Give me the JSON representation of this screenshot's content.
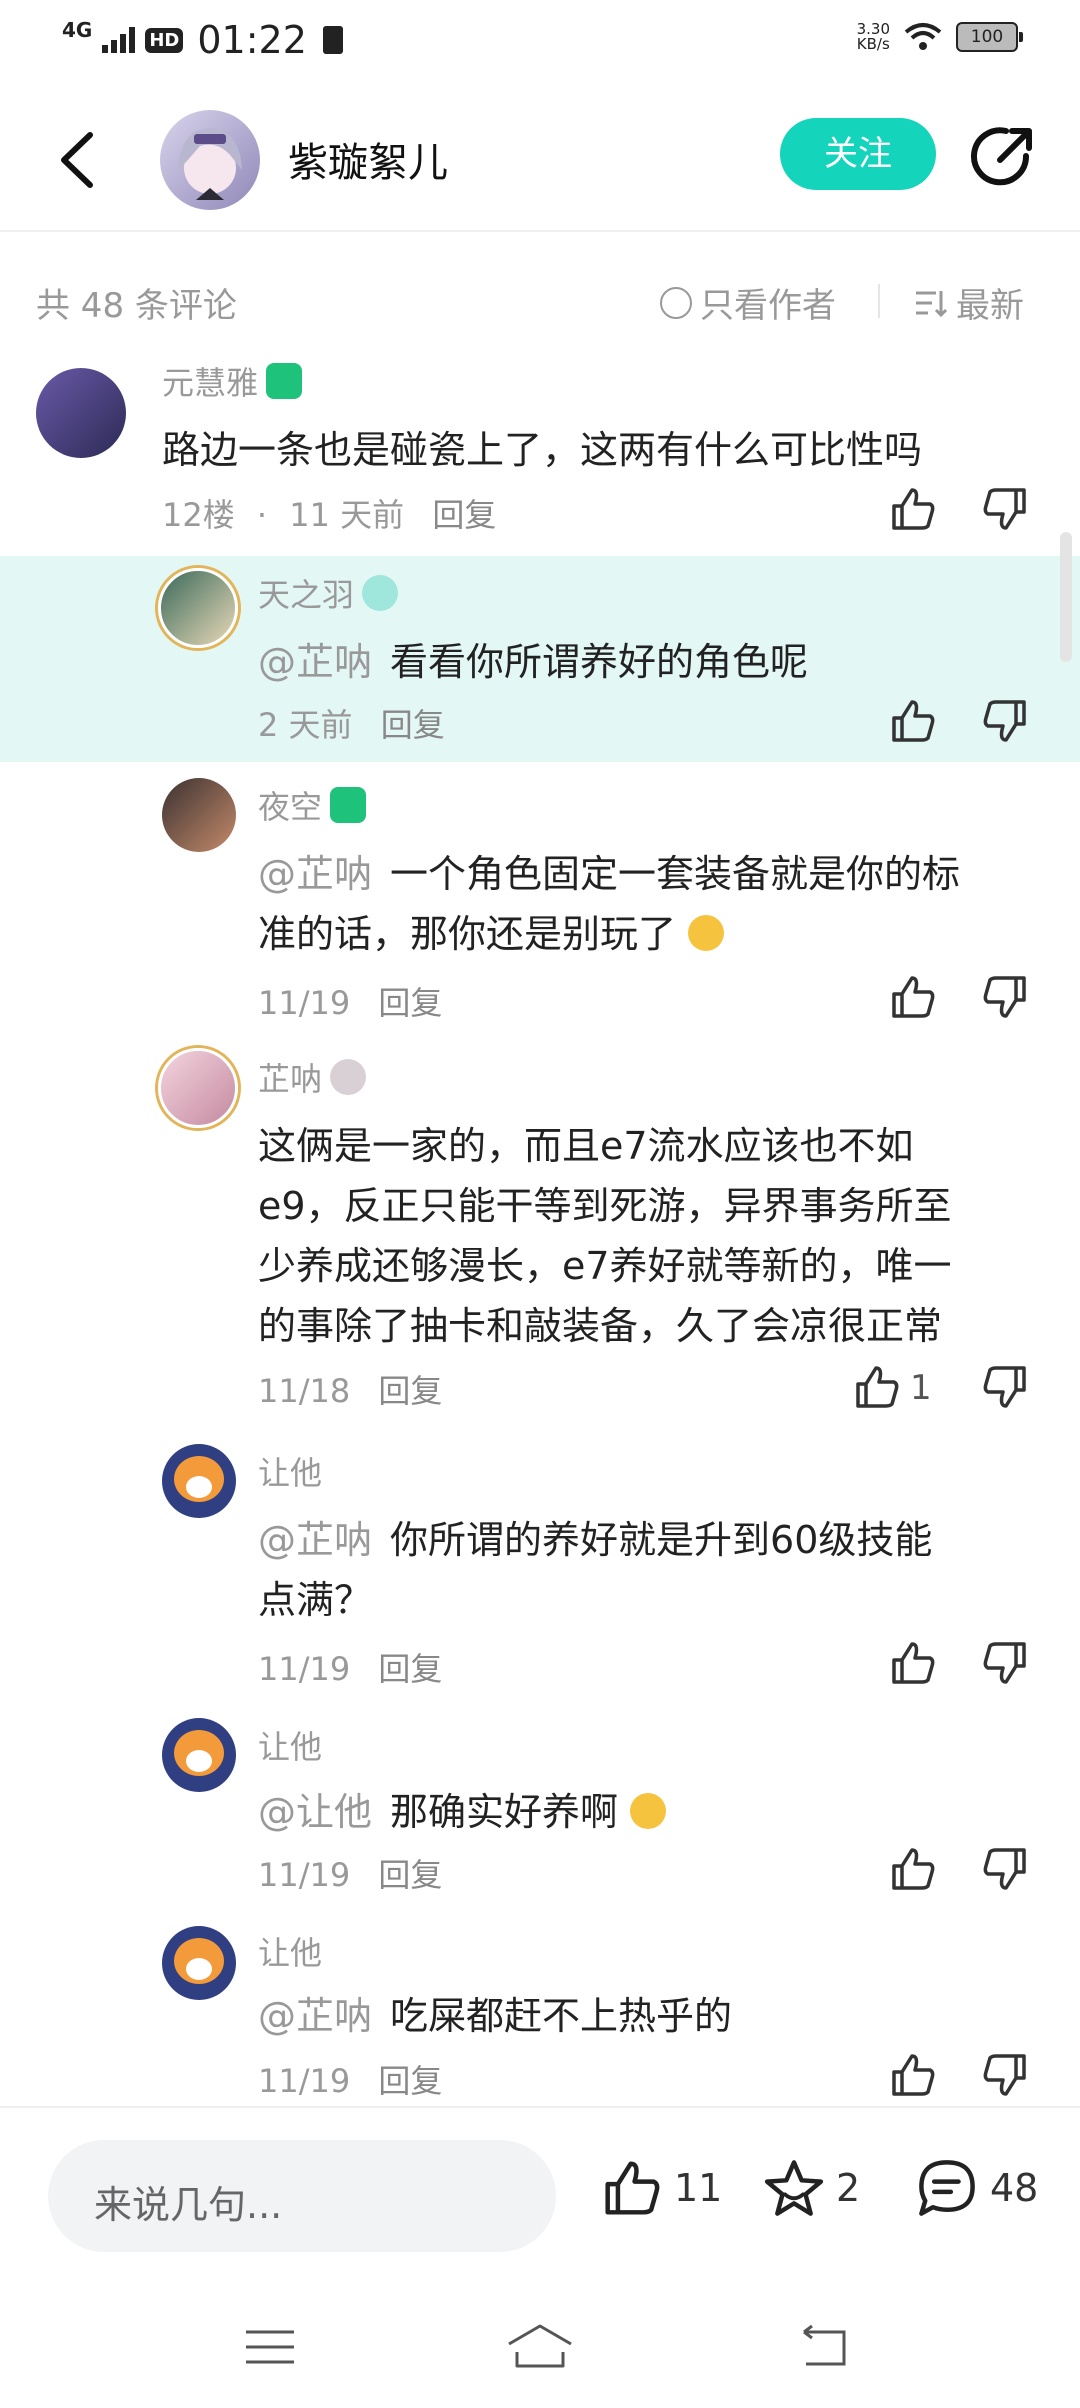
{
  "status_bar": {
    "network": "4G",
    "hd": "HD",
    "time": "01:22",
    "speed_value": "3.30",
    "speed_unit": "KB/s",
    "battery": "100"
  },
  "header": {
    "author_name": "紫璇絮儿",
    "follow_label": "关注"
  },
  "comments_bar": {
    "count_label": "共 48 条评论",
    "only_author_label": "只看作者",
    "sort_label": "最新"
  },
  "comments": [
    {
      "user": "元慧雅",
      "text": "路边一条也是碰瓷上了，这两有什么可比性吗",
      "floor": "12楼",
      "sep": "·",
      "time": "11 天前",
      "reply": "回复"
    },
    {
      "user": "天之羽",
      "mention": "@芷呐",
      "text": "看看你所谓养好的角色呢",
      "time": "2 天前",
      "reply": "回复"
    },
    {
      "user": "夜空",
      "mention": "@芷呐",
      "text_line1": "一个角色固定一套装备就是你的标",
      "text_line2": "准的话，那你还是别玩了",
      "time": "11/19",
      "reply": "回复"
    },
    {
      "user": "芷呐",
      "text_line1": "这俩是一家的，而且e7流水应该也不如",
      "text_line2": "e9，反正只能干等到死游，异界事务所至",
      "text_line3": "少养成还够漫长，e7养好就等新的，唯一",
      "text_line4": "的事除了抽卡和敲装备，久了会凉很正常",
      "time": "11/18",
      "reply": "回复",
      "likes": "1"
    },
    {
      "user": "让他",
      "mention": "@芷呐",
      "text_line1": "你所谓的养好就是升到60级技能",
      "text_line2": "点满？",
      "time": "11/19",
      "reply": "回复"
    },
    {
      "user": "让他",
      "mention": "@让他",
      "text": "那确实好养啊",
      "time": "11/19",
      "reply": "回复"
    },
    {
      "user": "让他",
      "mention": "@芷呐",
      "text": "吃屎都赶不上热乎的",
      "time": "11/19",
      "reply": "回复"
    }
  ],
  "bottom_bar": {
    "input_placeholder": "来说几句...",
    "like_count": "11",
    "star_count": "2",
    "comment_count": "48"
  }
}
